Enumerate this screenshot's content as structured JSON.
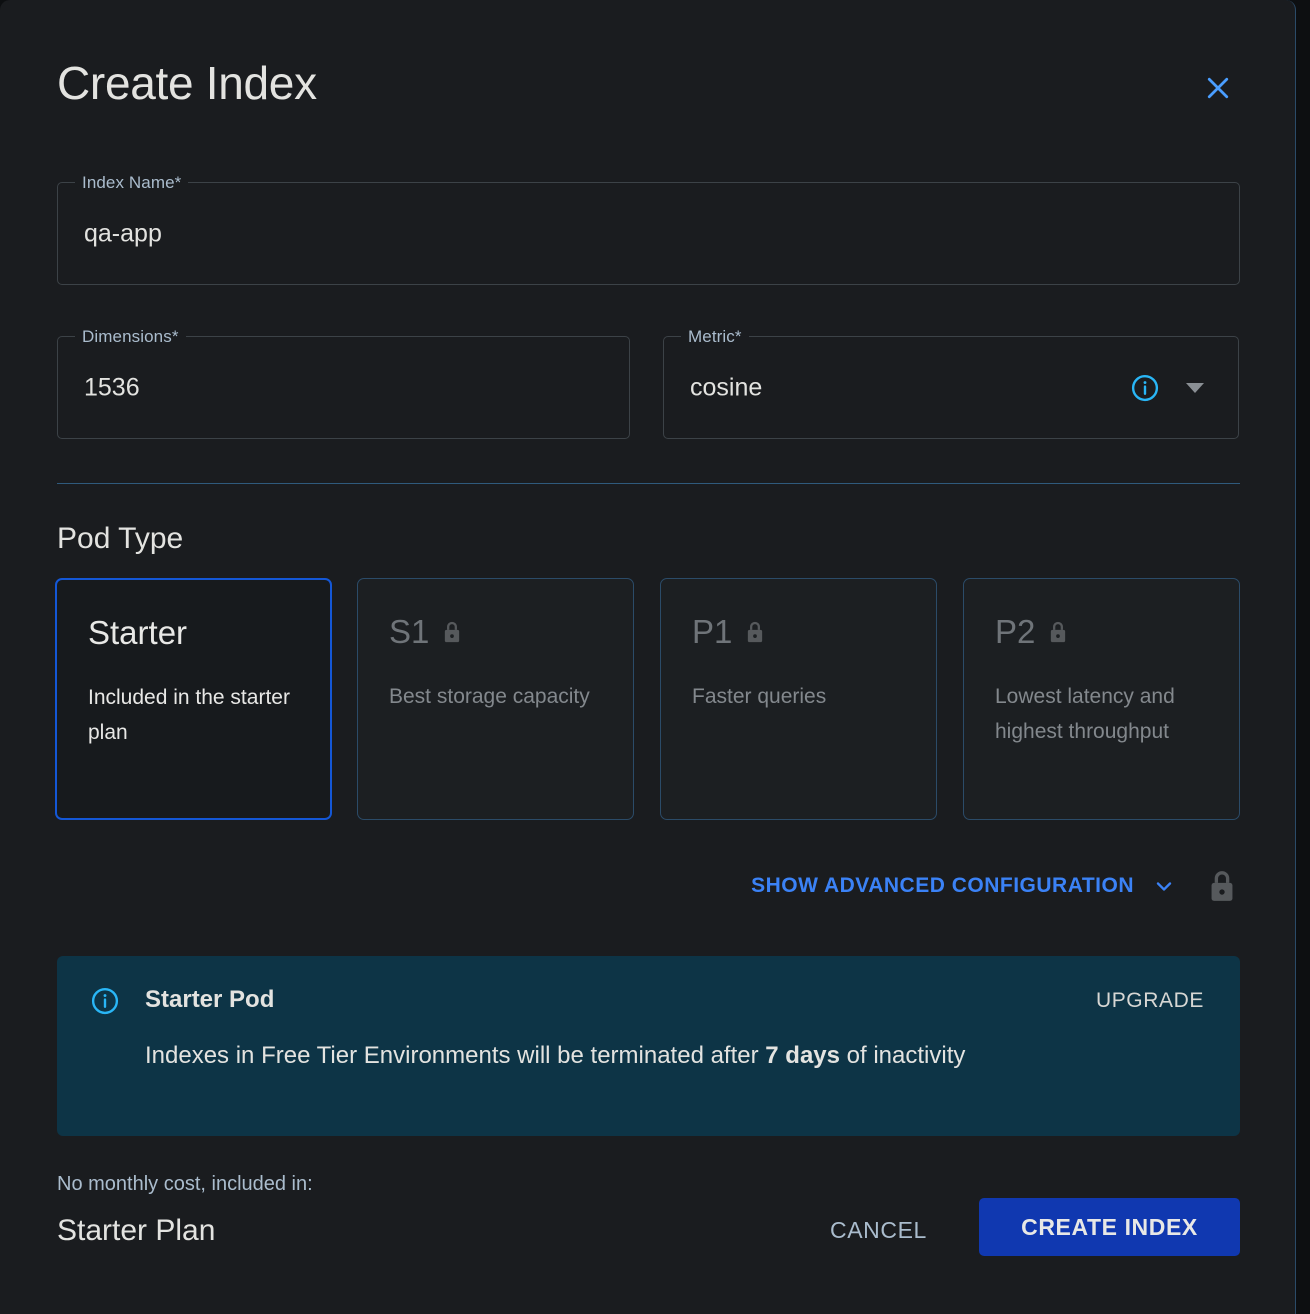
{
  "dialog": {
    "title": "Create Index",
    "close_icon": "close-icon"
  },
  "fields": {
    "index_name": {
      "label": "Index Name",
      "required_marker": "*",
      "value": "qa-app",
      "placeholder": ""
    },
    "dimensions": {
      "label": "Dimensions",
      "required_marker": "*",
      "value": "1536",
      "placeholder": ""
    },
    "metric": {
      "label": "Metric",
      "required_marker": "*",
      "value": "cosine",
      "placeholder": "",
      "info_icon": "info-circle-icon",
      "caret_icon": "chevron-down-icon"
    }
  },
  "pod_type": {
    "heading": "Pod Type",
    "cards": [
      {
        "name": "Starter",
        "description": "Included in the starter plan",
        "locked": false,
        "selected": true
      },
      {
        "name": "S1",
        "description": "Best storage capacity",
        "locked": true,
        "selected": false
      },
      {
        "name": "P1",
        "description": "Faster queries",
        "locked": true,
        "selected": false
      },
      {
        "name": "P2",
        "description": "Lowest latency and highest throughput",
        "locked": true,
        "selected": false
      }
    ]
  },
  "advanced": {
    "label": "SHOW ADVANCED CONFIGURATION",
    "chevron_icon": "chevron-down-icon",
    "lock_icon": "lock-icon"
  },
  "banner": {
    "icon": "info-circle-icon",
    "title": "Starter Pod",
    "upgrade_label": "UPGRADE",
    "text_before": "Indexes in Free Tier Environments will be terminated after ",
    "text_emphasis": "7 days",
    "text_after": " of inactivity"
  },
  "footer": {
    "cost_note": "No monthly cost, included in:",
    "plan_name": "Starter Plan",
    "cancel_label": "CANCEL",
    "create_label": "CREATE INDEX"
  },
  "colors": {
    "accent_blue": "#3b82f6",
    "primary_button": "#1038b0",
    "selected_border": "#1457d6",
    "banner_bg": "#0d3446",
    "info_icon": "#29b6f6",
    "label_blue": "#aabccd",
    "modal_bg": "#1a1c1f"
  }
}
